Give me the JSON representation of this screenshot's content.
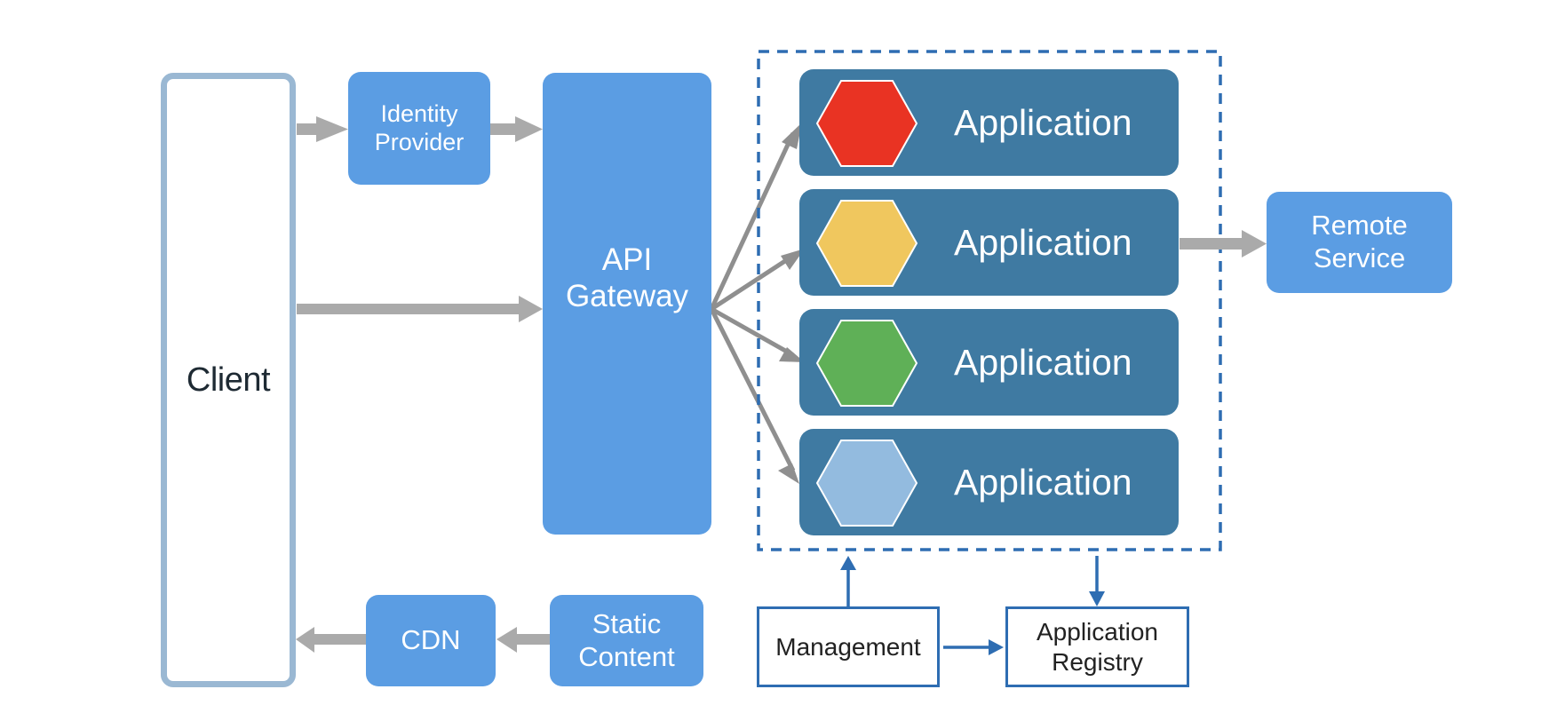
{
  "diagram": {
    "client": {
      "label": "Client"
    },
    "identity_provider": {
      "line1": "Identity",
      "line2": "Provider"
    },
    "api_gateway": {
      "line1": "API",
      "line2": "Gateway"
    },
    "cdn": {
      "label": "CDN"
    },
    "static_content": {
      "line1": "Static",
      "line2": "Content"
    },
    "applications": [
      {
        "label": "Application",
        "color": "#e93323",
        "color_name": "red"
      },
      {
        "label": "Application",
        "color": "#f0c75e",
        "color_name": "yellow"
      },
      {
        "label": "Application",
        "color": "#5fb057",
        "color_name": "green"
      },
      {
        "label": "Application",
        "color": "#93bbdf",
        "color_name": "light-blue"
      }
    ],
    "remote_service": {
      "line1": "Remote",
      "line2": "Service"
    },
    "management": {
      "label": "Management"
    },
    "application_registry": {
      "line1": "Application",
      "line2": "Registry"
    },
    "colors": {
      "component_blue": "#5b9de3",
      "application_teal": "#3f7aa2",
      "client_border": "#9ab8d3",
      "arrow_gray": "#aaaaaa",
      "fan_arrow_gray": "#8f8f8f",
      "control_blue": "#2e6db2"
    },
    "connections": [
      "Client -> Identity Provider",
      "Identity Provider -> API Gateway",
      "Client -> API Gateway",
      "API Gateway -> Application (x4)",
      "Application -> Remote Service",
      "Static Content -> CDN",
      "CDN -> Client",
      "Management -> Application group",
      "Application group -> Application Registry",
      "Management -> Application Registry"
    ]
  }
}
